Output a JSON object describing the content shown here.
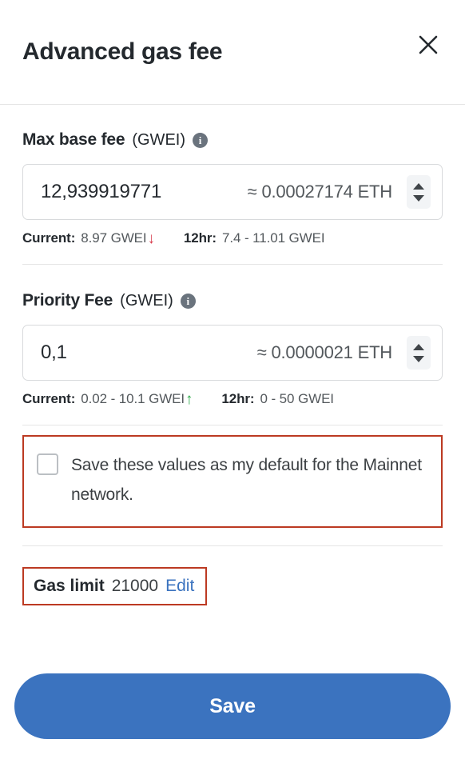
{
  "header": {
    "title": "Advanced gas fee",
    "close_icon": "close-icon"
  },
  "max_base_fee": {
    "label": "Max base fee",
    "unit": "(GWEI)",
    "info_icon": "info-icon",
    "value": "12,939919771",
    "eth_approx": "≈ 0.00027174 ETH",
    "stepper_up_icon": "chevron-up-icon",
    "stepper_down_icon": "chevron-down-icon",
    "current_key": "Current:",
    "current_value": "8.97 GWEI",
    "trend_icon": "↓",
    "trend_direction": "down",
    "trend_color": "#d73a49",
    "range_key": "12hr:",
    "range_value": "7.4 - 11.01 GWEI"
  },
  "priority_fee": {
    "label": "Priority Fee",
    "unit": "(GWEI)",
    "info_icon": "info-icon",
    "value": "0,1",
    "eth_approx": "≈ 0.0000021 ETH",
    "stepper_up_icon": "chevron-up-icon",
    "stepper_down_icon": "chevron-down-icon",
    "current_key": "Current:",
    "current_value": "0.02 - 10.1 GWEI",
    "trend_icon": "↑",
    "trend_direction": "up",
    "trend_color": "#28a745",
    "range_key": "12hr:",
    "range_value": "0 - 50 GWEI"
  },
  "save_default": {
    "checked": false,
    "text": "Save these values as my default for the Mainnet network."
  },
  "gas_limit": {
    "label": "Gas limit",
    "value": "21000",
    "edit_label": "Edit"
  },
  "footer": {
    "save_label": "Save"
  },
  "colors": {
    "accent": "#3b73bf",
    "annotation": "#bc3a22",
    "text": "#24292e",
    "muted": "#53585c",
    "border": "#d8dadc",
    "divider": "#e5e5e5"
  }
}
